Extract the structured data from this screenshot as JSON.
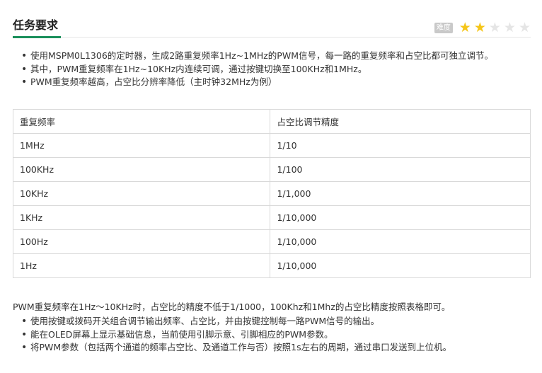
{
  "section": {
    "title": "任务要求",
    "difficulty_label": "难度",
    "rating": {
      "filled": 2,
      "total": 5
    }
  },
  "requirements": [
    "使用MSPM0L1306的定时器，生成2路重复频率1Hz~1MHz的PWM信号，每一路的重复频率和占空比都可独立调节。",
    "其中，PWM重复频率在1Hz~10KHz内连续可调，通过按键切换至100KHz和1MHz。",
    "PWM重复频率越高，占空比分辨率降低（主时钟32MHz为例）"
  ],
  "table": {
    "headers": [
      "重复频率",
      "占空比调节精度"
    ],
    "rows": [
      [
        "1MHz",
        "1/10"
      ],
      [
        "100KHz",
        "1/100"
      ],
      [
        "10KHz",
        "1/1,000"
      ],
      [
        "1KHz",
        "1/10,000"
      ],
      [
        "100Hz",
        "1/10,000"
      ],
      [
        "1Hz",
        "1/10,000"
      ]
    ]
  },
  "note": "PWM重复频率在1Hz～10KHz时，占空比的精度不低于1/1000，100Khz和1Mhz的占空比精度按照表格即可。",
  "extra_requirements": [
    "使用按键或拨码开关组合调节输出频率、占空比，并由按键控制每一路PWM信号的输出。",
    "能在OLED屏幕上显示基础信息，当前使用引脚示意、引脚相应的PWM参数。",
    "将PWM参数（包括两个通道的频率占空比、及通道工作与否）按照1s左右的周期，通过串口发送到上位机。"
  ],
  "colors": {
    "accent": "#1a8f5b",
    "star_on": "#f5c518",
    "star_off": "#e5e5e5"
  }
}
